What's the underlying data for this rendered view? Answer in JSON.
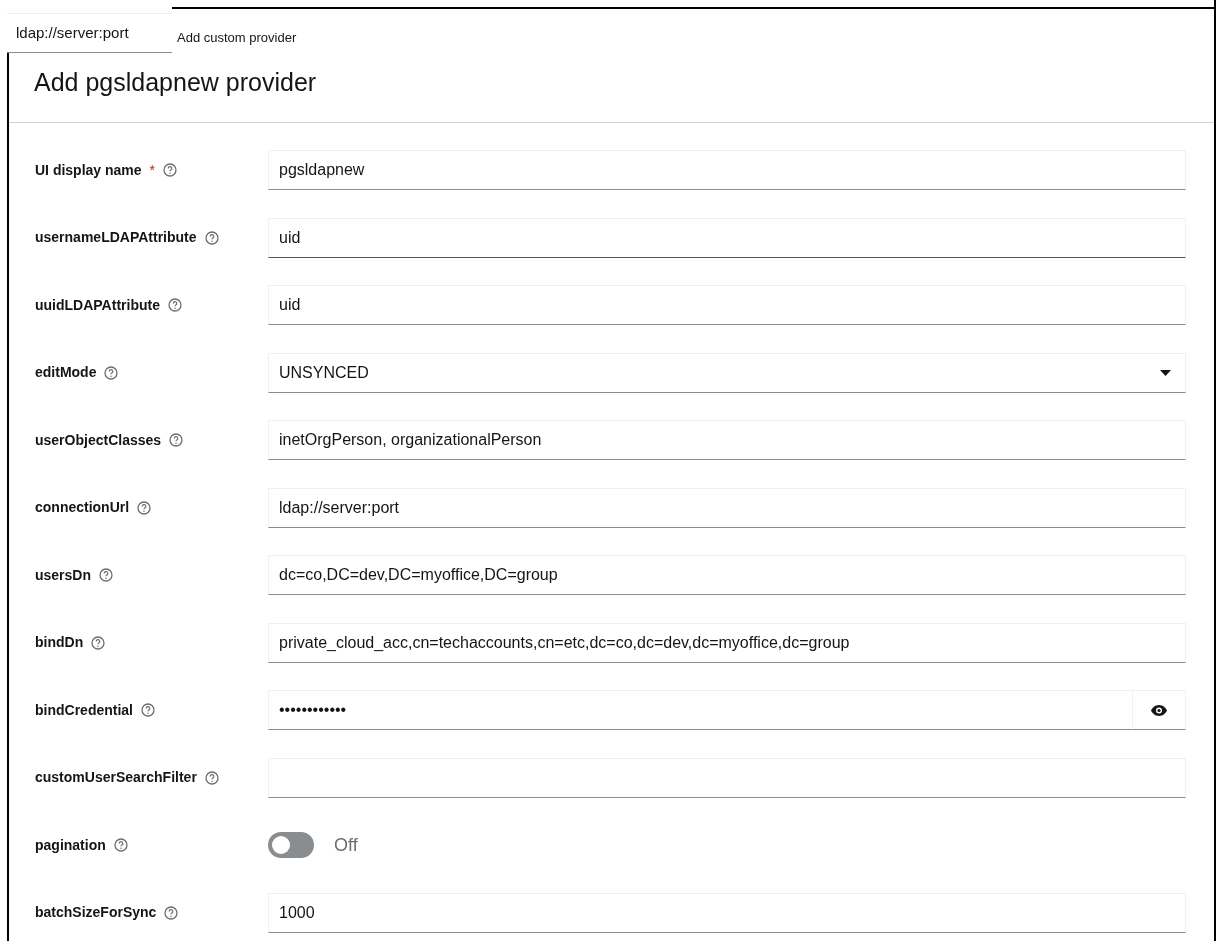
{
  "tooltip": {
    "text": "ldap://server:port"
  },
  "breadcrumb": "Add custom provider",
  "title": "Add pgsldapnew provider",
  "fields": [
    {
      "kind": "text",
      "label": "UI display name",
      "required_mark": "*",
      "value": "pgsldapnew",
      "focused": false
    },
    {
      "kind": "text",
      "label": "usernameLDAPAttribute",
      "value": "uid",
      "focused": true
    },
    {
      "kind": "text",
      "label": "uuidLDAPAttribute",
      "value": "uid",
      "focused": false
    },
    {
      "kind": "select",
      "label": "editMode",
      "value": "UNSYNCED",
      "focused": false
    },
    {
      "kind": "text",
      "label": "userObjectClasses",
      "value": "inetOrgPerson, organizationalPerson",
      "focused": false
    },
    {
      "kind": "text",
      "label": "connectionUrl",
      "value": "ldap://server:port",
      "focused": false
    },
    {
      "kind": "text",
      "label": "usersDn",
      "value": "dc=co,DC=dev,DC=myoffice,DC=group",
      "focused": false
    },
    {
      "kind": "text",
      "label": "bindDn",
      "value": "private_cloud_acc,cn=techaccounts,cn=etc,dc=co,dc=dev,dc=myoffice,dc=group",
      "focused": false
    },
    {
      "kind": "password",
      "label": "bindCredential",
      "value": "••••••••••••",
      "focused": false
    },
    {
      "kind": "text",
      "label": "customUserSearchFilter",
      "focused": false
    },
    {
      "kind": "toggle",
      "label": "pagination",
      "on": false,
      "state_text": "Off"
    },
    {
      "kind": "text",
      "label": "batchSizeForSync",
      "value": "1000",
      "focused": false
    }
  ]
}
